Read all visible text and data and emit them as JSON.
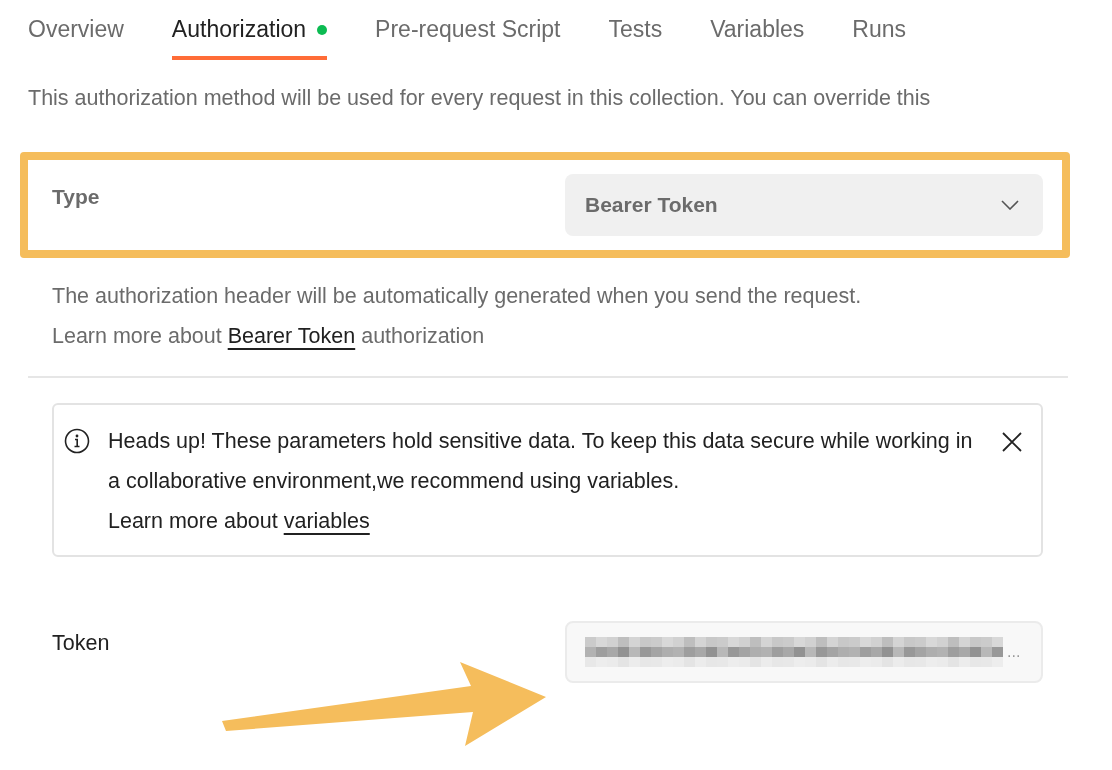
{
  "tabs": [
    {
      "label": "Overview",
      "selected": false,
      "dot": false
    },
    {
      "label": "Authorization",
      "selected": true,
      "dot": true
    },
    {
      "label": "Pre-request Script",
      "selected": false,
      "dot": false
    },
    {
      "label": "Tests",
      "selected": false,
      "dot": false
    },
    {
      "label": "Variables",
      "selected": false,
      "dot": false
    },
    {
      "label": "Runs",
      "selected": false,
      "dot": false
    }
  ],
  "description": "This authorization method will be used for every request in this collection. You can override this",
  "auth_type": {
    "label": "Type",
    "value": "Bearer Token",
    "highlighted": true
  },
  "help": {
    "text": "The authorization header will be automatically generated when you send the request.",
    "learn_prefix": "Learn more about",
    "link": "Bearer Token",
    "learn_suffix": "authorization"
  },
  "alert": {
    "text": "Heads up! These parameters hold sensitive data. To keep this data secure while working in a collaborative environment,we recommend using variables.",
    "learn_prefix": "Learn more about",
    "link": "variables"
  },
  "token": {
    "label": "Token",
    "redacted": true,
    "overflow_mark": "...",
    "pointed_at": true
  }
}
